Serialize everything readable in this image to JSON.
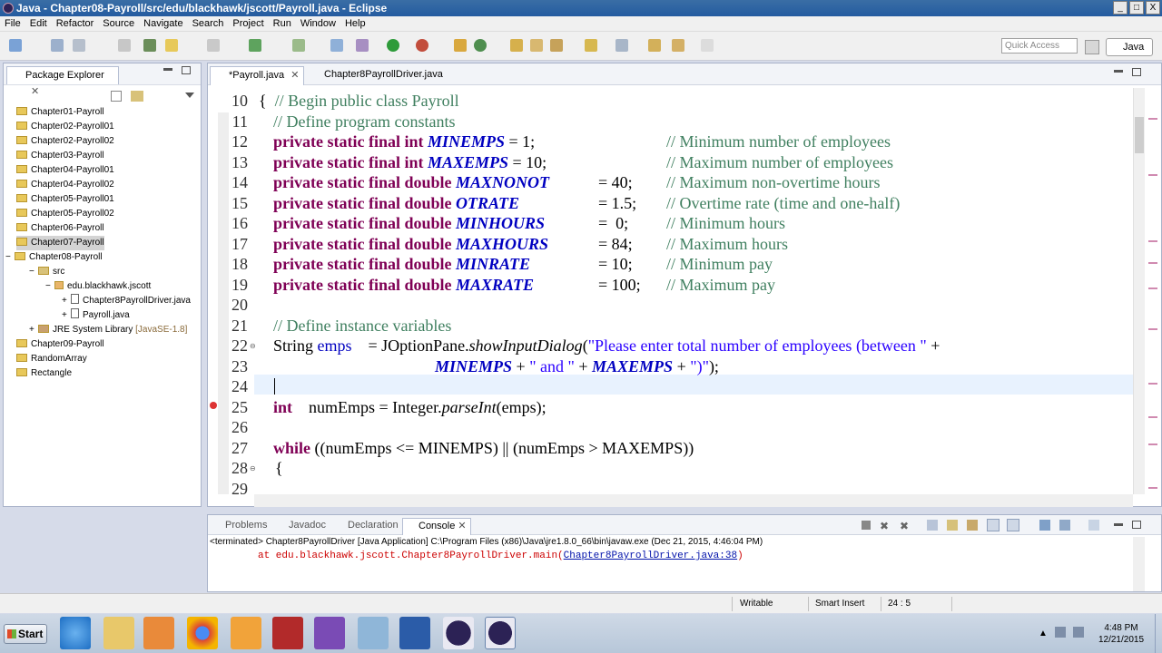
{
  "window": {
    "title": "Java - Chapter08-Payroll/src/edu/blackhawk/jscott/Payroll.java - Eclipse",
    "buttons": {
      "minimize": "_",
      "maximize": "□",
      "close": "X"
    }
  },
  "menu": [
    "File",
    "Edit",
    "Refactor",
    "Source",
    "Navigate",
    "Search",
    "Project",
    "Run",
    "Window",
    "Help"
  ],
  "toolbar": {
    "quick_access_placeholder": "Quick Access",
    "perspective": "Java"
  },
  "package_explorer": {
    "tab": "Package Explorer",
    "close": "✕",
    "projects": [
      "Chapter01-Payroll",
      "Chapter02-Payroll01",
      "Chapter02-Payroll02",
      "Chapter03-Payroll",
      "Chapter04-Payroll01",
      "Chapter04-Payroll02",
      "Chapter05-Payroll01",
      "Chapter05-Payroll02",
      "Chapter06-Payroll",
      "Chapter07-Payroll",
      "Chapter08-Payroll"
    ],
    "src": "src",
    "package": "edu.blackhawk.jscott",
    "files": [
      "Chapter8PayrollDriver.java",
      "Payroll.java"
    ],
    "jre": "JRE System Library",
    "jre_version": "[JavaSE-1.8]",
    "more_projects": [
      "Chapter09-Payroll",
      "RandomArray",
      "Rectangle"
    ],
    "expanders": {
      "minus": "−",
      "plus": "+"
    }
  },
  "editor": {
    "tabs": [
      {
        "label": "*Payroll.java",
        "close": "✕"
      },
      {
        "label": "Chapter8PayrollDriver.java"
      }
    ],
    "line_numbers": [
      "10",
      "11",
      "12",
      "13",
      "14",
      "15",
      "16",
      "17",
      "18",
      "19",
      "20",
      "21",
      "22",
      "23",
      "24",
      "25",
      "26",
      "27",
      "28",
      "29"
    ],
    "code": {
      "l10": {
        "brace": "{",
        "comment": "// Begin public class Payroll"
      },
      "l11": {
        "comment": "// Define program constants"
      },
      "l12": {
        "kw": "private static final int",
        "name": "MINEMPS",
        "rest": " = 1;",
        "comment": "// Minimum number of employees"
      },
      "l13": {
        "kw": "private static final int",
        "name": "MAXEMPS",
        "rest": " = 10;",
        "comment": "// Maximum number of employees"
      },
      "l14": {
        "kw": "private static final double",
        "name": "MAXNONOT",
        "rest": "= 40;",
        "comment": "// Maximum non-overtime hours"
      },
      "l15": {
        "kw": "private static final double",
        "name": "OTRATE",
        "rest": "= 1.5;",
        "comment": "// Overtime rate (time and one-half)"
      },
      "l16": {
        "kw": "private static final double",
        "name": "MINHOURS",
        "rest": "=  0;",
        "comment": "// Minimum hours"
      },
      "l17": {
        "kw": "private static final double",
        "name": "MAXHOURS",
        "rest": "= 84;",
        "comment": "// Maximum hours"
      },
      "l18": {
        "kw": "private static final double",
        "name": "MINRATE",
        "rest": "= 10;",
        "comment": "// Minimum pay"
      },
      "l19": {
        "kw": "private static final double",
        "name": "MAXRATE",
        "rest": "= 100;",
        "comment": "// Maximum pay"
      },
      "l21": {
        "comment": "// Define instance variables"
      },
      "l22": {
        "type": "String",
        "var": "emps",
        "eq": "= JOptionPane.",
        "method": "showInputDialog",
        "open": "(",
        "str": "\"Please enter total number of employees (between \"",
        "plus": " +"
      },
      "l23": {
        "c1": "MINEMPS",
        "p1": " + ",
        "s1": "\" and \"",
        "p2": " + ",
        "c2": "MAXEMPS",
        "p3": " + ",
        "s2": "\")\"",
        "end": ");"
      },
      "l25": {
        "kw": "int",
        "rest1": "numEmps = Integer.",
        "method": "parseInt",
        "rest2": "(emps);"
      },
      "l27": {
        "kw": "while",
        "rest": " ((numEmps <= MINEMPS) || (numEmps > MAXEMPS))"
      },
      "l28": {
        "brace": "{"
      }
    }
  },
  "console": {
    "tabs": [
      "Problems",
      "Javadoc",
      "Declaration",
      "Console"
    ],
    "close": "✕",
    "terminated": "<terminated> Chapter8PayrollDriver [Java Application] C:\\Program Files (x86)\\Java\\jre1.8.0_66\\bin\\javaw.exe (Dec 21, 2015, 4:46:04 PM)",
    "trace_prefix": "at edu.blackhawk.jscott.Chapter8PayrollDriver.main(",
    "trace_link": "Chapter8PayrollDriver.java:38",
    "trace_suffix": ")"
  },
  "status": {
    "writable": "Writable",
    "insert": "Smart Insert",
    "position": "24 : 5"
  },
  "taskbar": {
    "start": "Start",
    "time": "4:48 PM",
    "date": "12/21/2015"
  },
  "colors": {
    "keyword": "#7f0055",
    "constant": "#0000c0",
    "comment": "#3f7f5f",
    "string": "#2a00ff",
    "title": "#245ba0"
  }
}
